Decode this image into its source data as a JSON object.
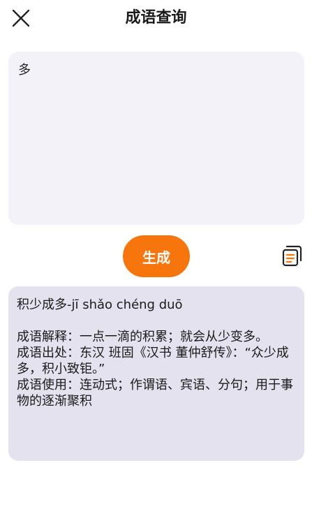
{
  "header": {
    "title": "成语查询",
    "close_icon": "close-icon"
  },
  "input": {
    "value": "多"
  },
  "actions": {
    "generate_label": "生成",
    "copy_icon": "copy-document-icon"
  },
  "result": {
    "headline": "积少成多-jī shǎo chéng duō",
    "explanation": "成语解释：一点一滴的积累；就会从少变多。",
    "source": "成语出处：东汉 班固《汉书 董仲舒传》：“众少成多，积小致钜。”",
    "usage": "成语使用：连动式；作谓语、宾语、分句；用于事物的逐渐聚积"
  },
  "colors": {
    "accent": "#f6750d",
    "input_bg": "#f3f2f9",
    "result_bg": "#e4e2ee"
  }
}
